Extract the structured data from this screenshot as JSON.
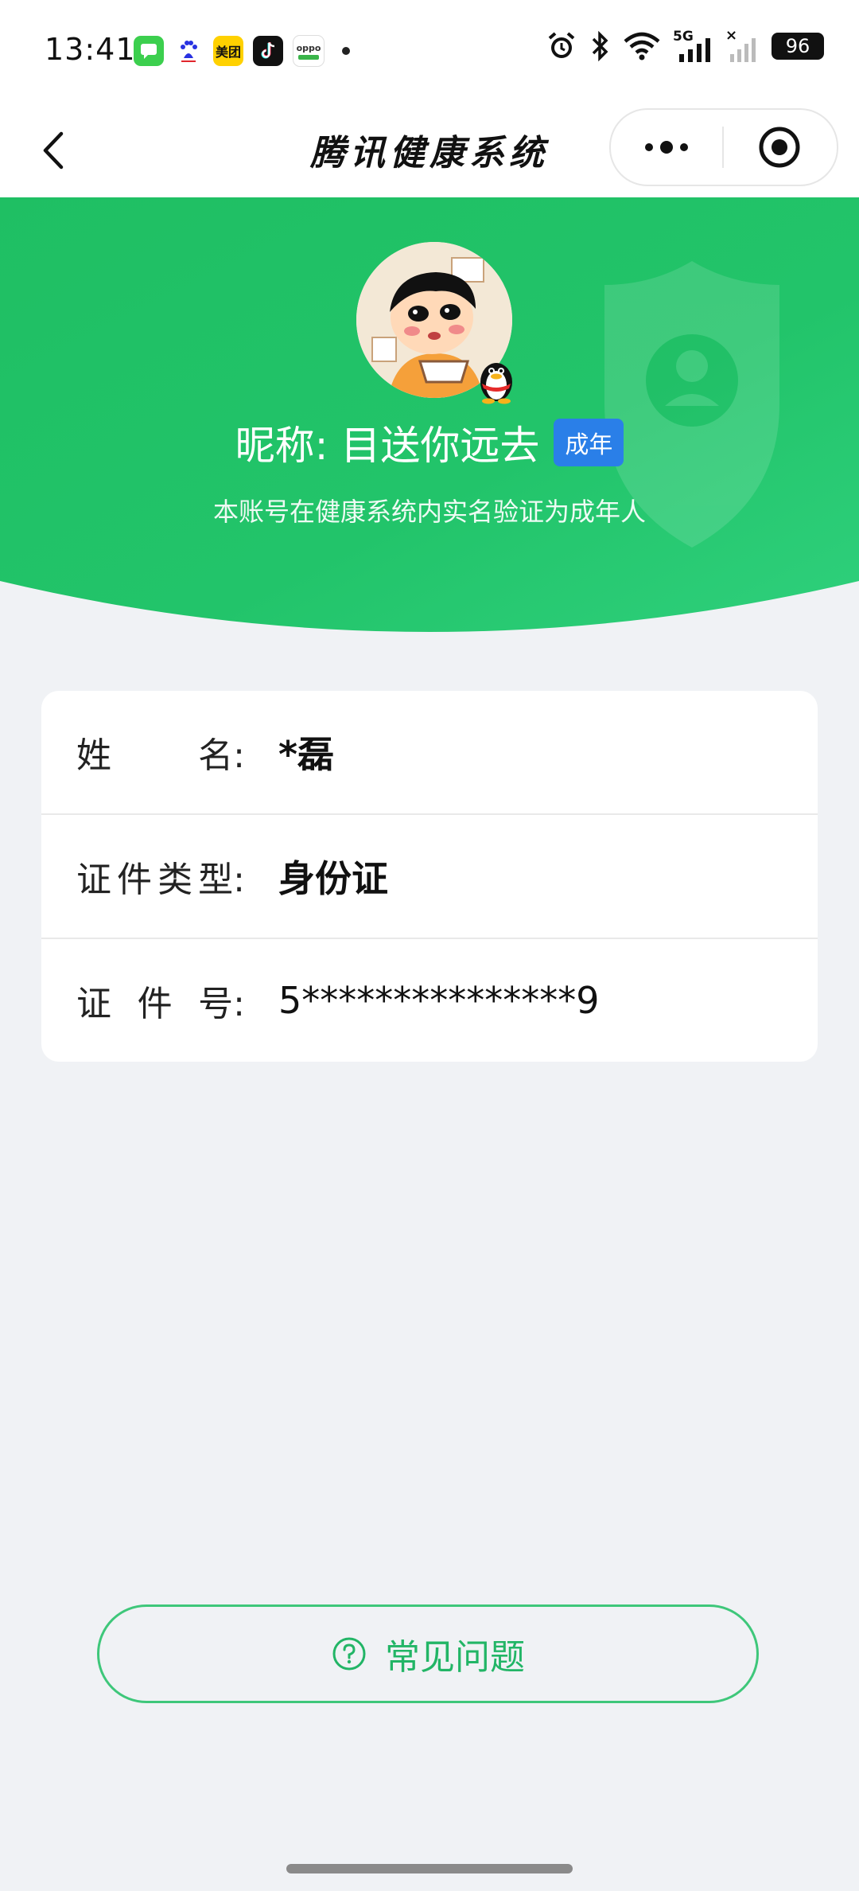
{
  "status_bar": {
    "time": "13:41",
    "battery": "96",
    "network": "5G",
    "app_icons": [
      {
        "name": "messages-icon",
        "color": "#3ccf4e"
      },
      {
        "name": "baidu-icon",
        "color": "#ffffff"
      },
      {
        "name": "meituan-icon",
        "color": "#ffd100",
        "text": "美团"
      },
      {
        "name": "tiktok-icon",
        "color": "#111111"
      },
      {
        "name": "oppo-icon",
        "color": "#ffffff",
        "text": "oppo"
      }
    ]
  },
  "nav": {
    "title": "腾讯健康系统"
  },
  "profile": {
    "nickname": "昵称: 目送你远去",
    "badge": "成年",
    "note": "本账号在健康系统内实名验证为成年人"
  },
  "info": {
    "rows": [
      {
        "label_chars": [
          "姓",
          "名:"
        ],
        "value": "*磊"
      },
      {
        "label_chars": [
          "证",
          "件",
          "类",
          "型:"
        ],
        "value": "身份证"
      },
      {
        "label_chars": [
          "证",
          "件",
          "号:"
        ],
        "value": "5***************9"
      }
    ]
  },
  "faq": {
    "label": "常见问题"
  },
  "colors": {
    "green_primary": "#22c16a",
    "badge_blue": "#2a7fe8",
    "faq_green": "#22b566"
  }
}
